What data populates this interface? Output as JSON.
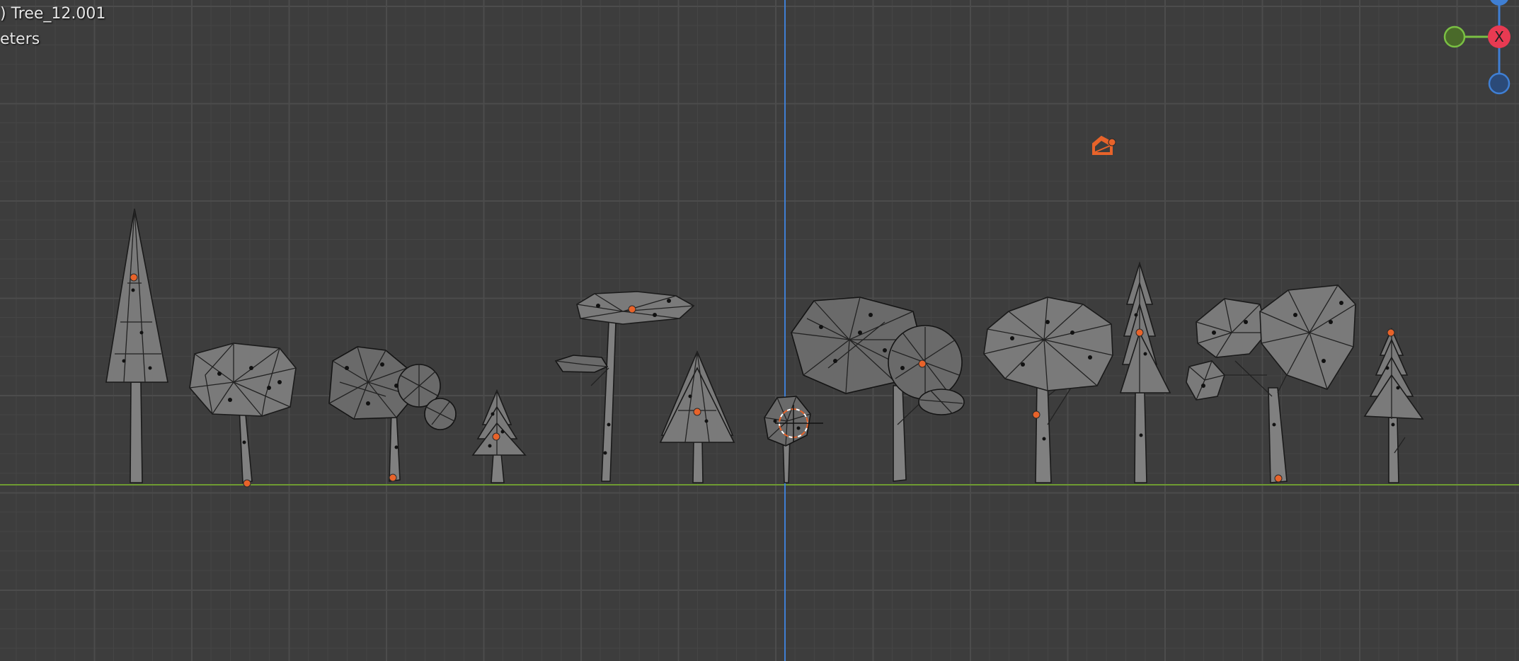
{
  "viewport": {
    "overlay": {
      "object_line": ") Tree_12.001",
      "units_line": "eters"
    },
    "navigation_gizmo": {
      "x_label": "X",
      "colors": {
        "x_axis": "#e83a52",
        "y_axis": "#7ac043",
        "z_axis": "#3f7fd4"
      }
    },
    "colors": {
      "background": "#3d3d3d",
      "grid_minor": "#454545",
      "grid_major": "#4c4c4c",
      "ground_line": "#6e9a32",
      "vertical_axis": "#3f7fd4",
      "object_origin": "#e8632a",
      "camera": "#e8632a"
    },
    "objects": [
      {
        "name": "tall-cone-pine-tree"
      },
      {
        "name": "round-lowpoly-tree"
      },
      {
        "name": "bushy-tree"
      },
      {
        "name": "small-tiered-pine"
      },
      {
        "name": "umbrella-pine-tree"
      },
      {
        "name": "triangular-tree"
      },
      {
        "name": "small-bush-tree"
      },
      {
        "name": "wide-canopy-tree"
      },
      {
        "name": "broad-round-tree"
      },
      {
        "name": "slim-tiered-pine"
      },
      {
        "name": "large-forked-tree"
      },
      {
        "name": "small-layered-pine"
      }
    ],
    "camera_icon": "camera-icon",
    "cursor_icon": "3d-cursor-icon"
  }
}
